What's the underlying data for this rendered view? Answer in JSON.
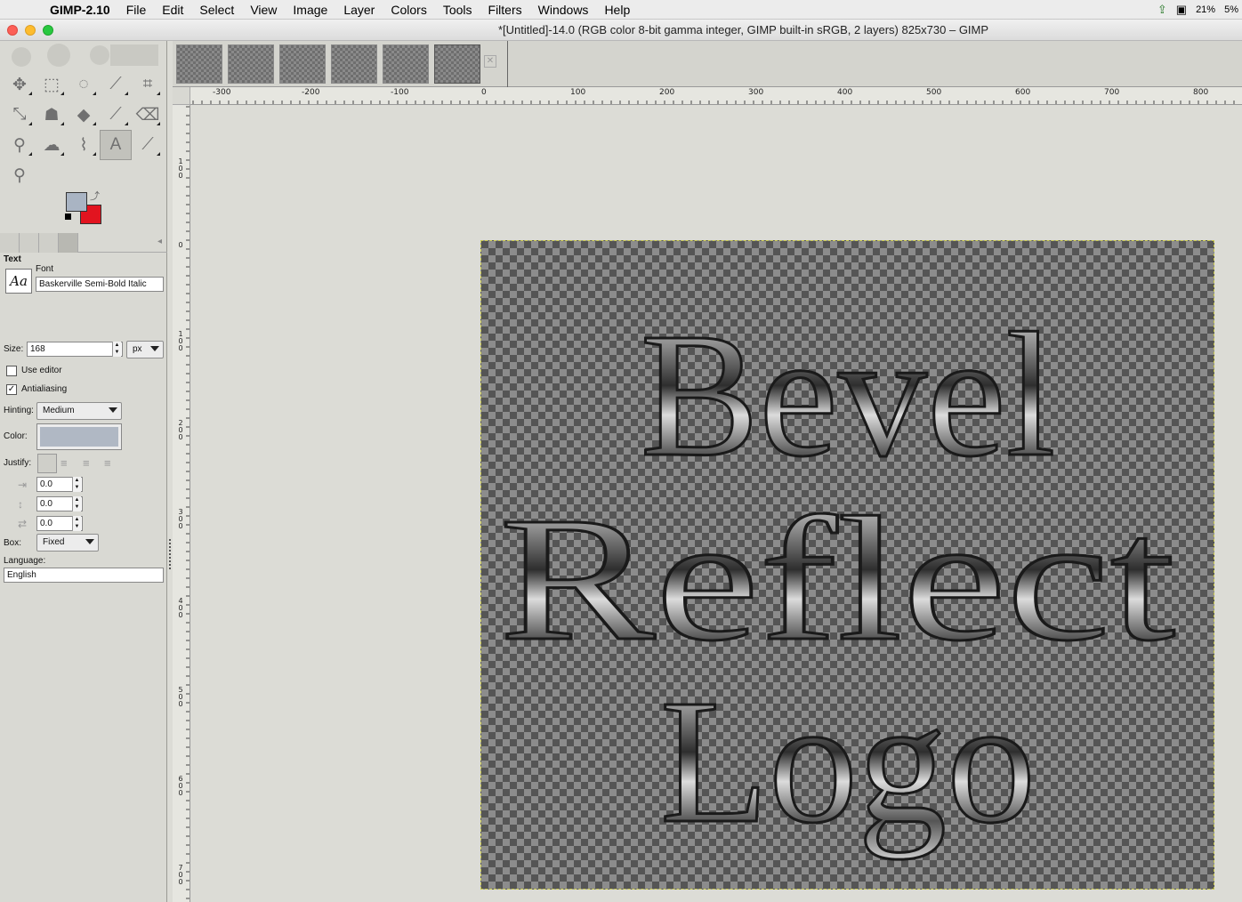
{
  "menubar": {
    "app_name": "GIMP-2.10",
    "items": [
      "File",
      "Edit",
      "Select",
      "View",
      "Image",
      "Layer",
      "Colors",
      "Tools",
      "Filters",
      "Windows",
      "Help"
    ],
    "status_right": [
      "21%",
      "5%"
    ]
  },
  "window": {
    "title": "*[Untitled]-14.0 (RGB color 8-bit gamma integer, GIMP built-in sRGB, 2 layers) 825x730 – GIMP"
  },
  "tools": {
    "icons": [
      "move-tool-icon",
      "rect-select-tool-icon",
      "free-select-tool-icon",
      "fuzzy-select-tool-icon",
      "crop-tool-icon",
      "unified-transform-tool-icon",
      "warp-transform-tool-icon",
      "bucket-fill-tool-icon",
      "paintbrush-tool-icon",
      "eraser-tool-icon",
      "clone-tool-icon",
      "smudge-tool-icon",
      "paths-tool-icon",
      "text-tool-icon",
      "color-picker-tool-icon",
      "zoom-tool-icon"
    ],
    "active_index": 13,
    "fg_color": "#a9b4c3",
    "bg_color": "#e2141f"
  },
  "tool_options": {
    "section_title": "Text",
    "font_label": "Font",
    "font_preview": "Aa",
    "font_value": "Baskerville Semi-Bold Italic",
    "size_label": "Size:",
    "size_value": "168",
    "size_unit": "px",
    "use_editor_label": "Use editor",
    "use_editor_checked": false,
    "antialiasing_label": "Antialiasing",
    "antialiasing_checked": true,
    "hinting_label": "Hinting:",
    "hinting_value": "Medium",
    "color_label": "Color:",
    "text_color": "#a9b4c3",
    "justify_label": "Justify:",
    "indent_value": "0.0",
    "line_spacing_value": "0.0",
    "letter_spacing_value": "0.0",
    "box_label": "Box:",
    "box_value": "Fixed",
    "language_label": "Language:",
    "language_value": "English"
  },
  "rulers": {
    "horizontal": [
      "-300",
      "-200",
      "-100",
      "0",
      "100",
      "200",
      "300",
      "400",
      "500",
      "600",
      "700",
      "800"
    ],
    "vertical": [
      "100",
      "0",
      "100",
      "200",
      "300",
      "400",
      "500",
      "600",
      "700"
    ]
  },
  "image_text": [
    "Bevel",
    "Reflect",
    "Logo"
  ]
}
